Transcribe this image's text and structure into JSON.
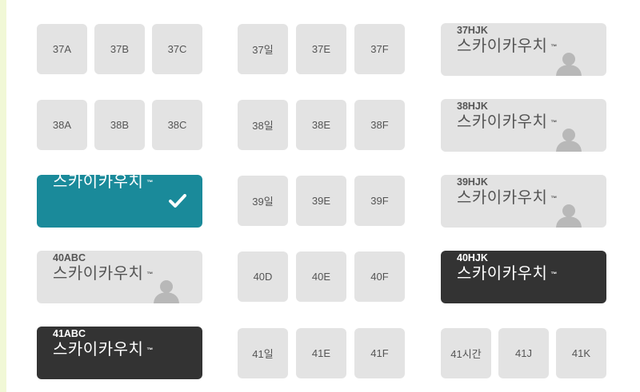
{
  "seat_rows": [
    {
      "left_group": [
        "37A",
        "37B",
        "37C"
      ],
      "middle_group": [
        "37일",
        "37E",
        "37F"
      ]
    },
    {
      "left_group": [
        "38A",
        "38B",
        "38C"
      ],
      "middle_group": [
        "38일",
        "38E",
        "38F"
      ]
    },
    {
      "middle_group": [
        "39일",
        "39E",
        "39F"
      ]
    },
    {
      "middle_group": [
        "40D",
        "40E",
        "40F"
      ]
    },
    {
      "middle_group": [
        "41일",
        "41E",
        "41F"
      ],
      "right_group": [
        "41시간",
        "41J",
        "41K"
      ]
    }
  ],
  "skycouch_rows": [
    {
      "code": "37HJK",
      "name": "스카이카우치",
      "tm": "™",
      "state": "available"
    },
    {
      "code": "38HJK",
      "name": "스카이카우치",
      "tm": "™",
      "state": "available"
    },
    {
      "code": "",
      "name": "스카이카우치",
      "tm": "™",
      "state": "selected"
    },
    {
      "code": "39HJK",
      "name": "스카이카우치",
      "tm": "™",
      "state": "available"
    },
    {
      "code": "40ABC",
      "name": "스카이카우치",
      "tm": "™",
      "state": "available"
    },
    {
      "code": "40HJK",
      "name": "스카이카우치",
      "tm": "™",
      "state": "occupied"
    },
    {
      "code": "41ABC",
      "name": "스카이카우치",
      "tm": "™",
      "state": "occupied"
    }
  ],
  "colors": {
    "available": "#e3e3e3",
    "selected": "#1a8a9a",
    "occupied": "#333333",
    "left_accent": "#f1f8d6"
  }
}
